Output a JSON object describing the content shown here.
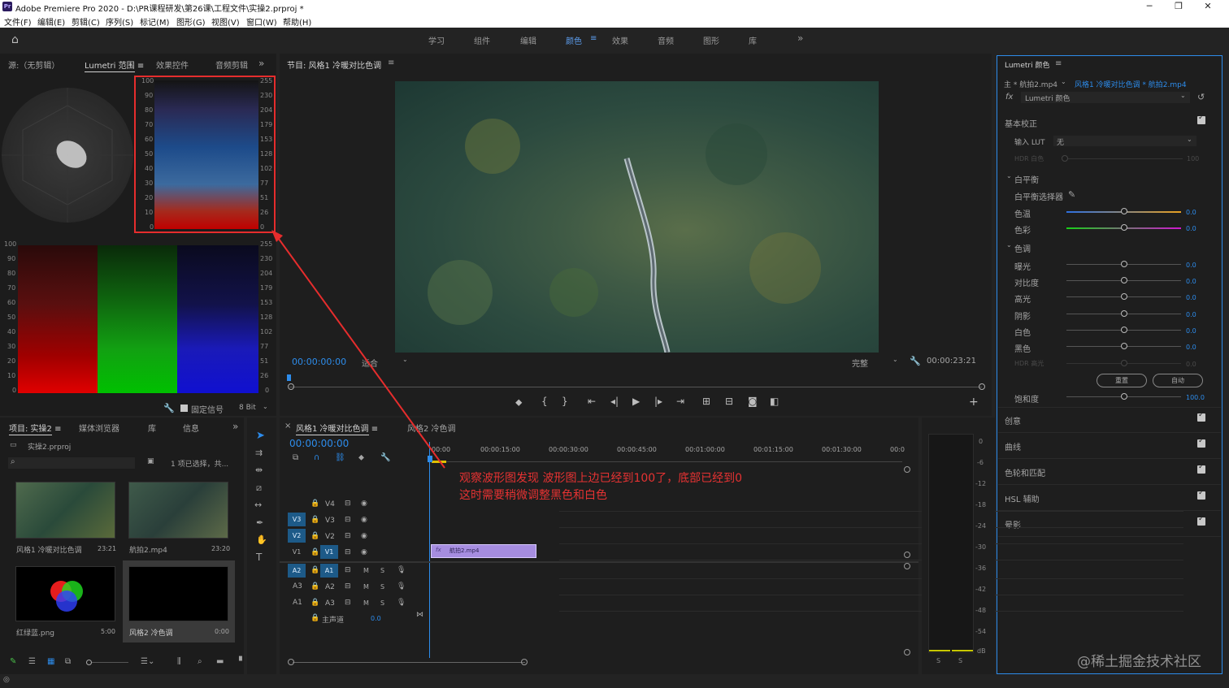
{
  "window": {
    "title": "Adobe Premiere Pro 2020 - D:\\PR课程研发\\第26课\\工程文件\\实操2.prproj *",
    "logo": "Pr"
  },
  "menu": [
    "文件(F)",
    "编辑(E)",
    "剪辑(C)",
    "序列(S)",
    "标记(M)",
    "图形(G)",
    "视图(V)",
    "窗口(W)",
    "帮助(H)"
  ],
  "workspaces": [
    "学习",
    "组件",
    "编辑",
    "颜色",
    "效果",
    "音频",
    "图形",
    "库"
  ],
  "workspace_active": "颜色",
  "source_panel": {
    "tabs": [
      "源:（无剪辑）",
      "Lumetri 范围",
      "效果控件",
      "音频剪辑"
    ],
    "left_scale": [
      "100",
      "90",
      "80",
      "70",
      "60",
      "50",
      "40",
      "30",
      "20",
      "10",
      "0"
    ],
    "right_scale": [
      "255",
      "230",
      "204",
      "179",
      "153",
      "128",
      "102",
      "77",
      "51",
      "26",
      "0"
    ],
    "fixed_signal": "固定信号",
    "bit_depth": "8 Bit"
  },
  "program_panel": {
    "title": "节目: 风格1 冷暖对比色调",
    "timecode_in": "00:00:00:00",
    "fit": "适合",
    "quality": "完整",
    "timecode_total": "00:00:23:21"
  },
  "lumetri": {
    "title": "Lumetri 颜色",
    "master": "主 * 航拍2.mp4",
    "clip": "风格1 冷暖对比色调 * 航拍2.mp4",
    "fx": "Lumetri 颜色",
    "basic": "基本校正",
    "input_lut": "输入 LUT",
    "lut_value": "无",
    "hdr_white": "HDR 白色",
    "hdr_white_val": "100",
    "white_balance": "白平衡",
    "wb_picker": "白平衡选择器",
    "temp": "色温",
    "tint": "色彩",
    "tone": "色调",
    "exposure": "曝光",
    "contrast": "对比度",
    "highlights": "高光",
    "shadows": "阴影",
    "whites": "白色",
    "blacks": "黑色",
    "hdr_spec": "HDR 高光",
    "reset": "重置",
    "auto": "自动",
    "saturation": "饱和度",
    "zero": "0.0",
    "sat_val": "100.0",
    "sections": [
      "创意",
      "曲线",
      "色轮和匹配",
      "HSL 辅助",
      "晕影"
    ]
  },
  "project": {
    "tabs": [
      "项目: 实操2",
      "媒体浏览器",
      "库",
      "信息"
    ],
    "file": "实操2.prproj",
    "selection": "1 项已选择，共...",
    "items": [
      {
        "name": "风格1 冷暖对比色调",
        "dur": "23:21"
      },
      {
        "name": "航拍2.mp4",
        "dur": "23:20"
      },
      {
        "name": "红绿蓝.png",
        "dur": "5:00"
      },
      {
        "name": "风格2 冷色调",
        "dur": "0:00"
      }
    ]
  },
  "timeline": {
    "tabs": [
      "风格1 冷暖对比色调",
      "风格2 冷色调"
    ],
    "timecode": "00:00:00:00",
    "ruler": [
      "00:00",
      "00:00:15:00",
      "00:00:30:00",
      "00:00:45:00",
      "00:01:00:00",
      "00:01:15:00",
      "00:01:30:00",
      "00:0"
    ],
    "video_tracks": [
      "V4",
      "V3",
      "V2",
      "V1"
    ],
    "audio_tracks": [
      "A1",
      "A2",
      "A3"
    ],
    "master": "主声道",
    "master_val": "0.0",
    "clip_name": "航拍2.mp4",
    "annotation_1": "观察波形图发现 波形图上边已经到100了，底部已经到0",
    "annotation_2": "这时需要稍微调整黑色和白色",
    "m": "M",
    "s": "S"
  },
  "meter_scale": [
    "0",
    "-6",
    "-12",
    "-18",
    "-24",
    "-30",
    "-36",
    "-42",
    "-48",
    "-54",
    "dB"
  ],
  "watermark": "@稀土掘金技术社区"
}
